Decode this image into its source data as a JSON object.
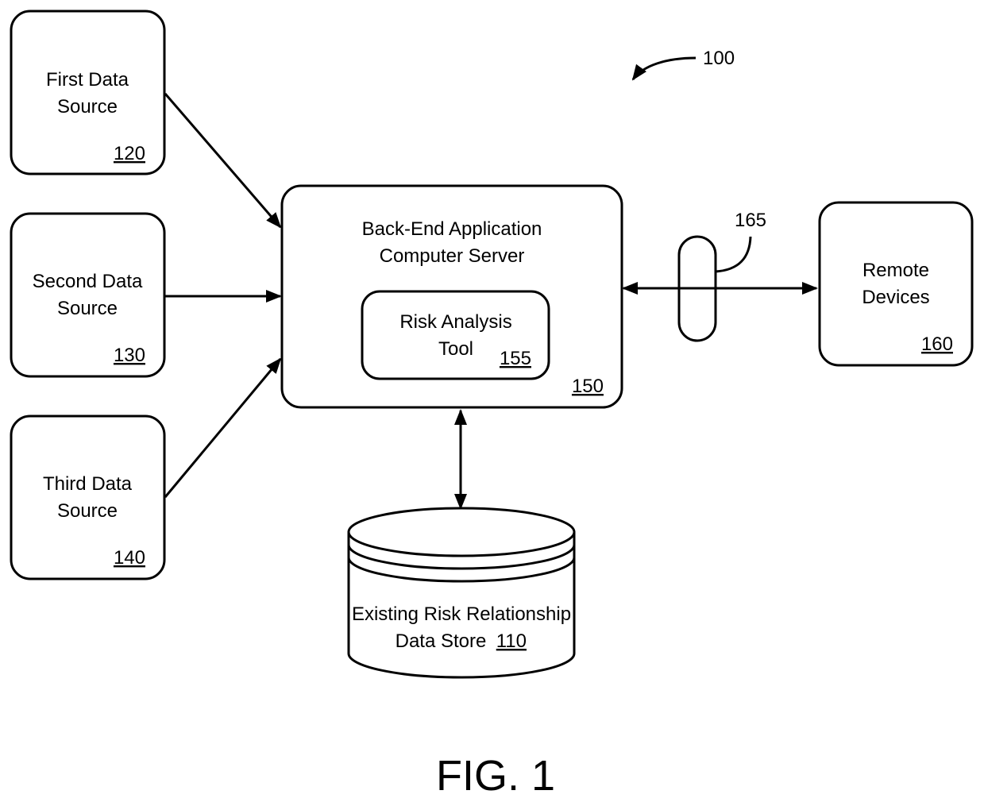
{
  "figure": {
    "label": "FIG. 1",
    "system_ref": "100"
  },
  "nodes": {
    "first_source": {
      "line1": "First Data",
      "line2": "Source",
      "ref": "120"
    },
    "second_source": {
      "line1": "Second Data",
      "line2": "Source",
      "ref": "130"
    },
    "third_source": {
      "line1": "Third Data",
      "line2": "Source",
      "ref": "140"
    },
    "server": {
      "line1": "Back-End Application",
      "line2": "Computer Server",
      "ref": "150"
    },
    "risk_tool": {
      "line1": "Risk Analysis",
      "line2": "Tool",
      "ref": "155"
    },
    "remote_devices": {
      "line1": "Remote",
      "line2": "Devices",
      "ref": "160"
    },
    "data_store": {
      "line1": "Existing Risk Relationship",
      "line2": "Data Store",
      "ref": "110"
    },
    "network": {
      "ref": "165"
    }
  },
  "edges": [
    {
      "from": "first_source",
      "to": "server",
      "direction": "one-way"
    },
    {
      "from": "second_source",
      "to": "server",
      "direction": "one-way"
    },
    {
      "from": "third_source",
      "to": "server",
      "direction": "one-way"
    },
    {
      "from": "server",
      "to": "remote_devices",
      "via": "network",
      "direction": "two-way"
    },
    {
      "from": "server",
      "to": "data_store",
      "direction": "two-way"
    }
  ]
}
